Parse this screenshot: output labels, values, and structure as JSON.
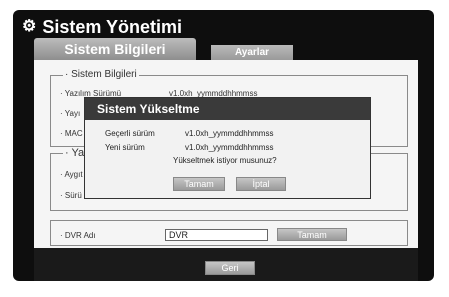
{
  "window": {
    "title": "Sistem Yönetimi",
    "icon": "gear-icon"
  },
  "tabs": [
    {
      "label": "Sistem Bilgileri",
      "active": true
    },
    {
      "label": "Ayarlar",
      "active": false
    }
  ],
  "system_info": {
    "group_title": "Sistem Bilgileri",
    "rows": [
      {
        "label": "Yazılım Sürümü",
        "value": "v1.0xh_yymmddhhmmss"
      },
      {
        "label": "Yayı"
      },
      {
        "label": "MAC"
      }
    ]
  },
  "second_group": {
    "group_title": "Yaz",
    "rows": [
      {
        "label": "Aygıt"
      },
      {
        "label": "Sürü"
      }
    ]
  },
  "dvr": {
    "label": "DVR Adı",
    "value": "DVR",
    "ok_label": "Tamam"
  },
  "footer": {
    "back_label": "Geri"
  },
  "dialog": {
    "title": "Sistem Yükseltme",
    "current_label": "Geçerli sürüm",
    "current_value": "v1.0xh_yymmddhhmmss",
    "new_label": "Yeni sürüm",
    "new_value": "v1.0xh_yymmddhhmmss",
    "question": "Yükseltmek istiyor musunuz?",
    "ok_label": "Tamam",
    "cancel_label": "İptal"
  }
}
